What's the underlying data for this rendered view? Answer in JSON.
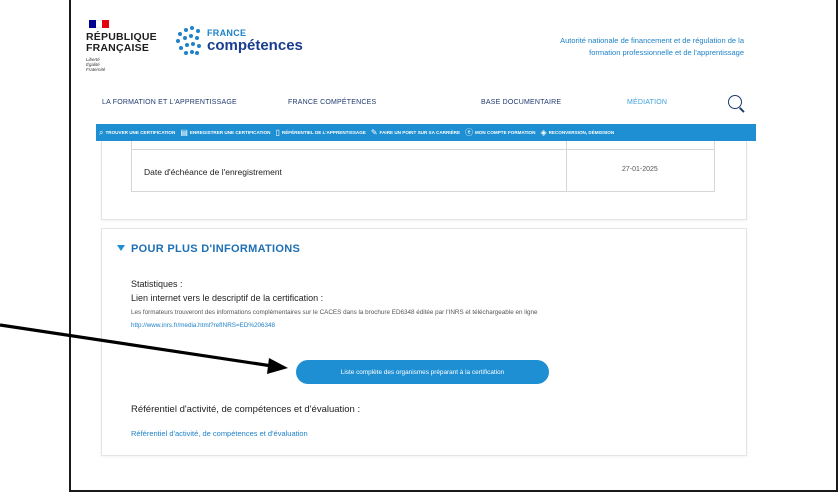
{
  "header": {
    "republique_line1": "RÉPUBLIQUE",
    "republique_line2": "FRANÇAISE",
    "motto": [
      "Liberté",
      "Égalité",
      "Fraternité"
    ],
    "brand_small": "FRANCE",
    "brand_big": "compétences",
    "tagline_line1": "Autorité nationale de financement et de régulation de la",
    "tagline_line2": "formation professionnelle et de l'apprentissage"
  },
  "main_nav": {
    "items": [
      "LA FORMATION ET L'APPRENTISSAGE",
      "FRANCE COMPÉTENCES",
      "BASE DOCUMENTAIRE",
      "MÉDIATION"
    ],
    "active_index": 3
  },
  "blue_bar": {
    "items": [
      {
        "icon": "search-icon",
        "glyph": "⌕",
        "label": "TROUVER UNE CERTIFICATION"
      },
      {
        "icon": "register-icon",
        "glyph": "▤",
        "label": "ENREGISTRER UNE CERTIFICATION"
      },
      {
        "icon": "document-icon",
        "glyph": "▯",
        "label": "RÉFÉRENTIEL DE L'APPRENTISSAGE"
      },
      {
        "icon": "pencil-icon",
        "glyph": "✎",
        "label": "FAIRE UN POINT SUR SA CARRIÈRE"
      },
      {
        "icon": "euro-icon",
        "glyph": "ⓔ",
        "label": "MON COMPTE FORMATION"
      },
      {
        "icon": "diamond-icon",
        "glyph": "◈",
        "label": "RECONVERSION, DÉMISSION"
      }
    ]
  },
  "table": {
    "label": "Date d'échéance de l'enregistrement",
    "value": "27-01-2025"
  },
  "info": {
    "section_title": "POUR PLUS D'INFORMATIONS",
    "statistiques": "Statistiques :",
    "lien_title": "Lien internet vers le descriptif de la certification :",
    "description": "Les formateurs trouveront des informations complémentaires sur le CACES dans la brochure ED6348 éditée par l'INRS et téléchargeable en ligne",
    "url": "http://www.inrs.fr/media.html?refINRS=ED%206348",
    "cta_label": "Liste complète des organismes préparant à la certification",
    "ref_title": "Référentiel d'activité, de compétences et d'évaluation :",
    "ref_link": "Référentiel d'activité, de compétences et d'évaluation"
  },
  "colors": {
    "primary_blue": "#1e8fd2",
    "link_blue": "#1e82c8",
    "flag_blue": "#000091",
    "flag_red": "#e1000f",
    "arrow": "#000000"
  }
}
